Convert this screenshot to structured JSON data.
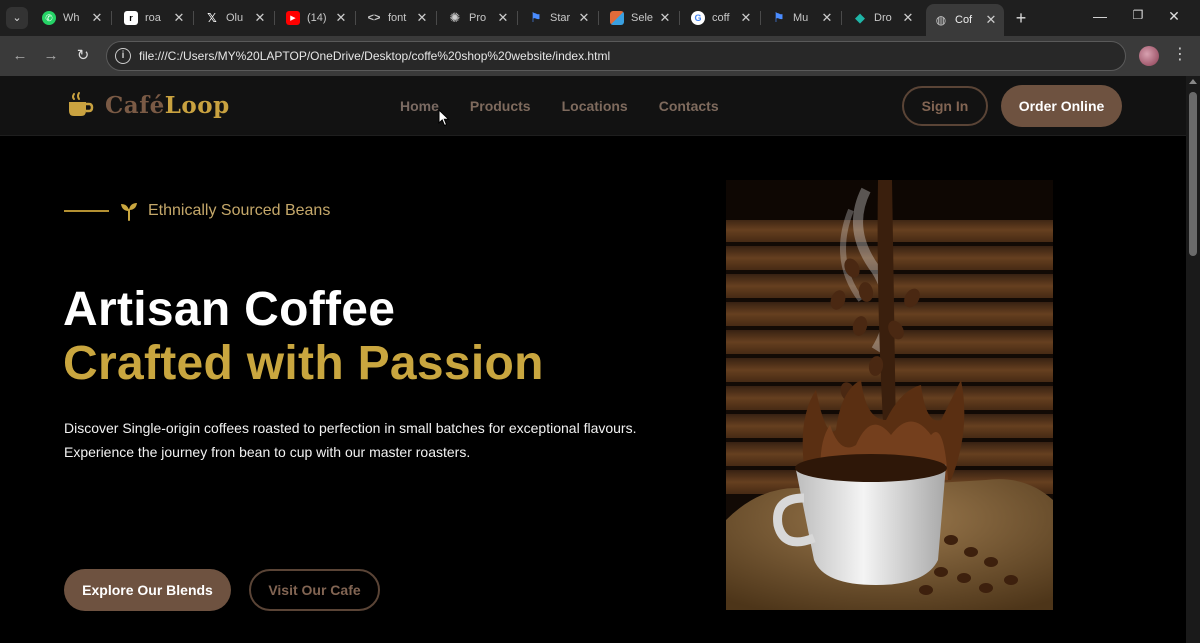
{
  "browser": {
    "tabs": [
      {
        "label": "Wh",
        "icon": "whatsapp-icon",
        "color": "#25d366"
      },
      {
        "label": "roa",
        "icon": "roadmap-icon",
        "color": "#ffffff"
      },
      {
        "label": "Olu",
        "icon": "x-icon",
        "color": "#ffffff"
      },
      {
        "label": "(14)",
        "icon": "youtube-icon",
        "color": "#ff0000"
      },
      {
        "label": "font",
        "icon": "code-icon",
        "color": "#cccccc"
      },
      {
        "label": "Pro",
        "icon": "openai-icon",
        "color": "#cccccc"
      },
      {
        "label": "Star",
        "icon": "flag-icon",
        "color": "#4a8cff"
      },
      {
        "label": "Sele",
        "icon": "grid-icon",
        "color": "#e06b3a"
      },
      {
        "label": "coff",
        "icon": "google-icon",
        "color": "#4285f4"
      },
      {
        "label": "Mu",
        "icon": "flag-icon",
        "color": "#4a8cff"
      },
      {
        "label": "Dro",
        "icon": "diamond-icon",
        "color": "#1fb5a7"
      },
      {
        "label": "Cof",
        "icon": "globe-icon",
        "color": "#cccccc"
      }
    ],
    "url": "file:///C:/Users/MY%20LAPTOP/OneDrive/Desktop/coffe%20shop%20website/index.html"
  },
  "site": {
    "logo": {
      "part1": "Café",
      "part2": "Loop"
    },
    "nav": [
      "Home",
      "Products",
      "Locations",
      "Contacts"
    ],
    "signin": "Sign In",
    "order": "Order Online",
    "tagline": "Ethnically Sourced Beans",
    "headline_white": "Artisan Coffee",
    "headline_gold": "Crafted with Passion",
    "description": [
      "Discover Single-origin coffees roasted to perfection in small batches for exceptional flavours.",
      "Experience the journey fron bean to cup with our master roasters."
    ],
    "cta_primary": "Explore Our Blends",
    "cta_secondary": "Visit Our Cafe"
  },
  "colors": {
    "accent_gold": "#c9a63f",
    "brand_brown": "#6e5240",
    "background": "#000000"
  }
}
